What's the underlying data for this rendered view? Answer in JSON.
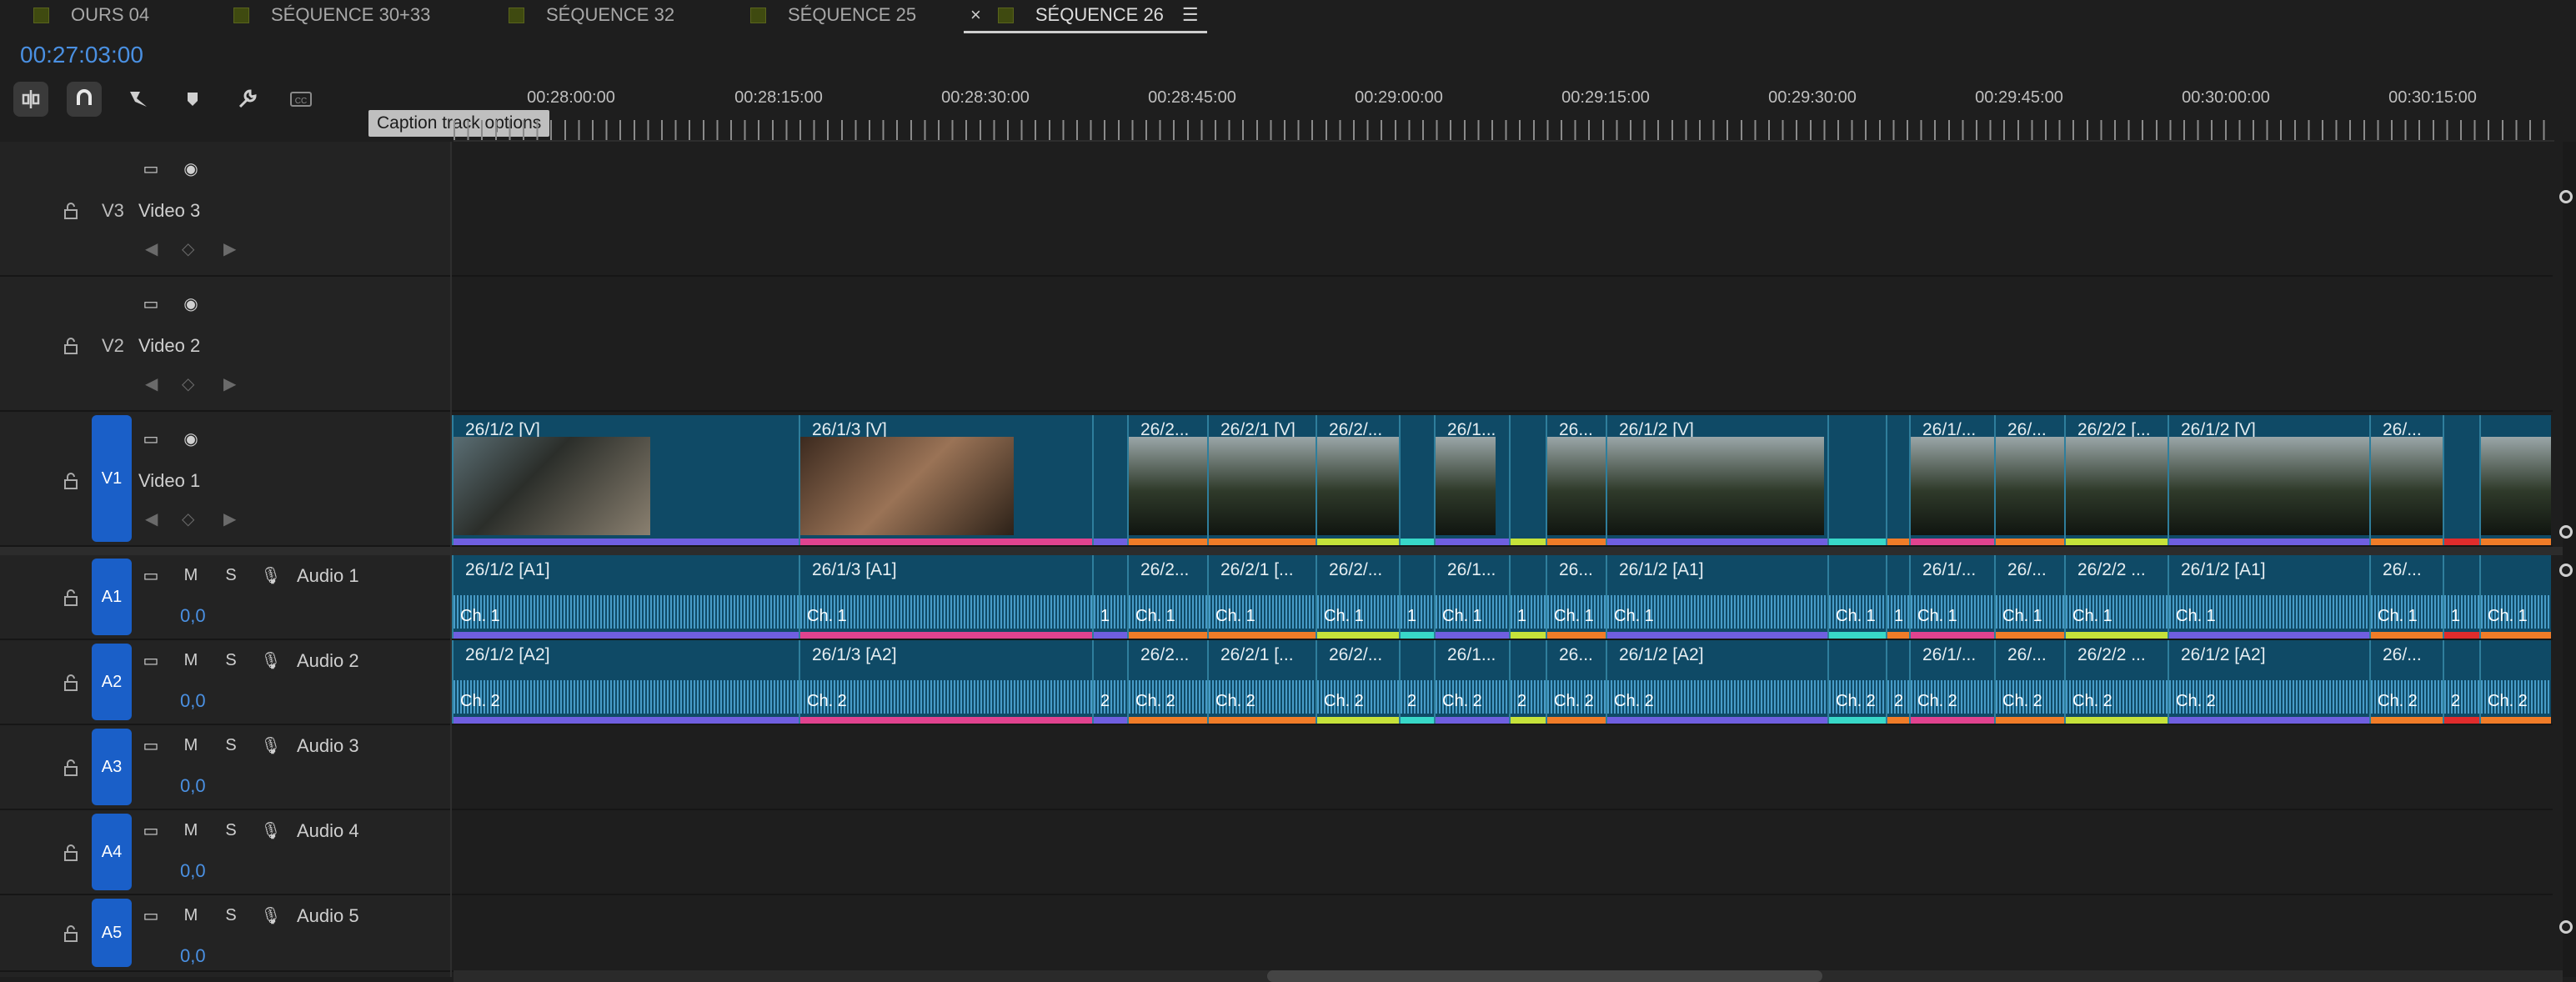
{
  "tabs": [
    {
      "label": "OURS 04"
    },
    {
      "label": "SÉQUENCE 30+33"
    },
    {
      "label": "SÉQUENCE 32"
    },
    {
      "label": "SÉQUENCE 25"
    },
    {
      "label": "SÉQUENCE 26",
      "active": true
    }
  ],
  "timecode": "00:27:03:00",
  "tooltip": "Caption track options",
  "ruler": [
    "00:28:00:00",
    "00:28:15:00",
    "00:28:30:00",
    "00:28:45:00",
    "00:29:00:00",
    "00:29:15:00",
    "00:29:30:00",
    "00:29:45:00",
    "00:30:00:00",
    "00:30:15:00"
  ],
  "tracks": {
    "video": [
      {
        "id": "V3",
        "name": "Video 3"
      },
      {
        "id": "V2",
        "name": "Video 2"
      },
      {
        "id": "V1",
        "name": "Video 1"
      }
    ],
    "audio": [
      {
        "id": "A1",
        "name": "Audio 1",
        "volume": "0,0"
      },
      {
        "id": "A2",
        "name": "Audio 2",
        "volume": "0,0"
      },
      {
        "id": "A3",
        "name": "Audio 3",
        "volume": "0,0"
      },
      {
        "id": "A4",
        "name": "Audio 4",
        "volume": "0,0"
      },
      {
        "id": "A5",
        "name": "Audio 5",
        "volume": "0,0"
      }
    ],
    "mute_label": "M",
    "solo_label": "S"
  },
  "clips_v1": [
    {
      "label": "26/1/2 [V]",
      "color": "#6f5fe0"
    },
    {
      "label": "26/1/3 [V]",
      "color": "#e0438f"
    },
    {
      "label": "",
      "color": "#6f5fe0"
    },
    {
      "label": "26/2...",
      "color": "#f07c28"
    },
    {
      "label": "26/2/1 [V]",
      "color": "#f07c28"
    },
    {
      "label": "26/2/...",
      "color": "#c6e23a"
    },
    {
      "label": "",
      "color": "#38d8c8"
    },
    {
      "label": "26/1...",
      "color": "#6f5fe0"
    },
    {
      "label": "",
      "color": "#c6e23a"
    },
    {
      "label": "26...",
      "color": "#f07c28"
    },
    {
      "label": "26/1/2 [V]",
      "color": "#6f5fe0"
    },
    {
      "label": "",
      "color": "#38d8c8"
    },
    {
      "label": "",
      "color": "#f07c28"
    },
    {
      "label": "26/1/...",
      "color": "#e0438f"
    },
    {
      "label": "26/...",
      "color": "#f07c28"
    },
    {
      "label": "26/2/2 [...",
      "color": "#c6e23a"
    },
    {
      "label": "26/1/2 [V]",
      "color": "#6f5fe0"
    },
    {
      "label": "26/...",
      "color": "#f07c28"
    },
    {
      "label": "",
      "color": "#e02c2c"
    },
    {
      "label": "",
      "color": "#f07c28"
    }
  ],
  "clips_a1": [
    "26/1/2 [A1]",
    "26/1/3 [A1]",
    "",
    "26/2...",
    "26/2/1 [...",
    "26/2/...",
    "",
    "26/1...",
    "",
    "26...",
    "26/1/2 [A1]",
    "",
    "",
    "26/1/...",
    "26/...",
    "26/2/2 ...",
    "26/1/2 [A1]",
    "26/...",
    "",
    ""
  ],
  "clips_a2": [
    "26/1/2 [A2]",
    "26/1/3 [A2]",
    "",
    "26/2...",
    "26/2/1 [...",
    "26/2/...",
    "",
    "26/1...",
    "",
    "26...",
    "26/1/2 [A2]",
    "",
    "",
    "26/1/...",
    "26/...",
    "26/2/2 ...",
    "26/1/2 [A2]",
    "26/...",
    "",
    ""
  ],
  "ch_a1": [
    "Ch. 1",
    "Ch. 1",
    "1",
    "Ch. 1",
    "Ch. 1",
    "Ch. 1",
    "1",
    "Ch. 1",
    "1",
    "Ch. 1",
    "Ch. 1",
    "Ch. 1",
    "1",
    "Ch. 1",
    "Ch. 1",
    "Ch. 1",
    "Ch. 1",
    "Ch. 1",
    "1",
    "Ch. 1"
  ],
  "ch_a2": [
    "Ch. 2",
    "Ch. 2",
    "2",
    "Ch. 2",
    "Ch. 2",
    "Ch. 2",
    "2",
    "Ch. 2",
    "2",
    "Ch. 2",
    "Ch. 2",
    "Ch. 2",
    "2",
    "Ch. 2",
    "Ch. 2",
    "Ch. 2",
    "Ch. 2",
    "Ch. 2",
    "2",
    "Ch. 2"
  ]
}
